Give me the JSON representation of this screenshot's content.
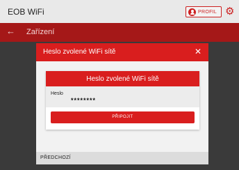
{
  "app": {
    "title": "EOB WiFi"
  },
  "header": {
    "profile_label": "PROFIL",
    "profile_icon": "user-icon",
    "settings_icon": "gear-icon"
  },
  "nav": {
    "back_icon": "arrow-left-icon",
    "title": "Zařízení"
  },
  "dialog": {
    "title": "Heslo zvolené WiFi sítě",
    "close_icon": "close-icon",
    "card": {
      "title": "Heslo zvolené WiFi sítě",
      "password_label": "Heslo",
      "password_value": "********",
      "connect_label": "PŘIPOJIT"
    },
    "footer": {
      "prev_label": "PŘEDCHOZÍ"
    }
  },
  "colors": {
    "accent": "#d91e1e",
    "nav_bg": "#a51818",
    "topbar_bg": "#e9e9e9",
    "backdrop": "#3a3a3a"
  }
}
